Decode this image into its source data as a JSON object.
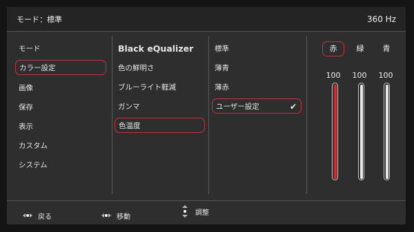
{
  "header": {
    "mode_label": "モード：標準",
    "refresh_rate": "360 Hz"
  },
  "menu": {
    "col1": [
      "モード",
      "カラー設定",
      "画像",
      "保存",
      "表示",
      "カスタム",
      "システム"
    ],
    "col2": [
      "Black eQualizer",
      "色の鮮明さ",
      "ブルーライト軽減",
      "ガンマ",
      "色温度"
    ],
    "col3": [
      "標準",
      "薄青",
      "薄赤",
      "ユーザー設定"
    ],
    "channels": [
      {
        "label": "赤",
        "value": "100",
        "level": 1.0,
        "color": "#e0262d"
      },
      {
        "label": "緑",
        "value": "100",
        "level": 1.0,
        "color": "#e6e6e6"
      },
      {
        "label": "青",
        "value": "100",
        "level": 1.0,
        "color": "#e6e6e6"
      }
    ]
  },
  "footer": {
    "back": "戻る",
    "move": "移動",
    "adjust": "調整"
  },
  "colors": {
    "accent": "#c8323a"
  }
}
